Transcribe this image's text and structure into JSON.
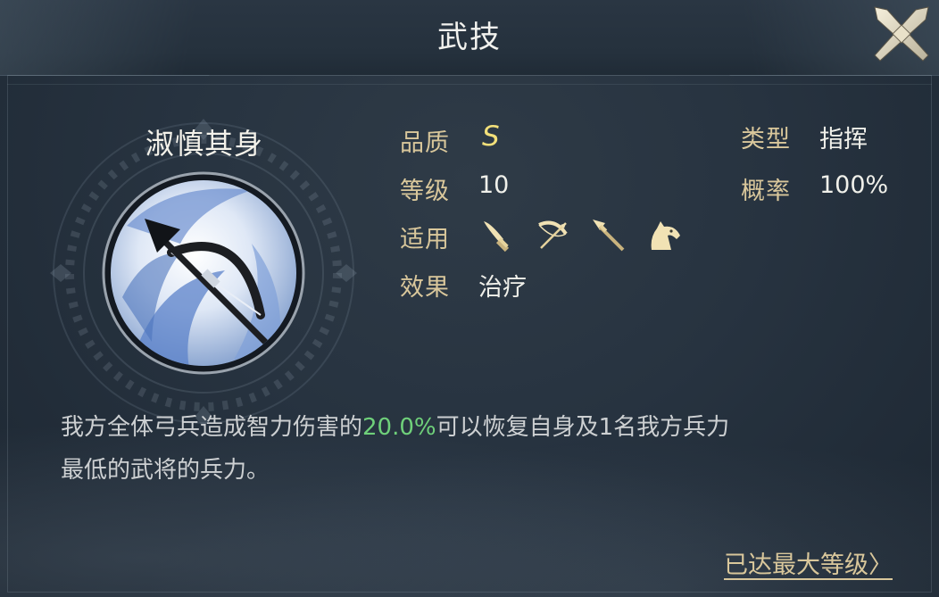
{
  "header": {
    "title": "武技"
  },
  "skill": {
    "name": "淑慎其身",
    "quality_label": "品质",
    "quality_value": "S",
    "level_label": "等级",
    "level_value": "10",
    "applicable_label": "适用",
    "applicable_icons": [
      "saber-icon",
      "bow-icon",
      "spear-icon",
      "horse-icon"
    ],
    "effect_label": "效果",
    "effect_value": "治疗",
    "type_label": "类型",
    "type_value": "指挥",
    "rate_label": "概率",
    "rate_value": "100%"
  },
  "description": {
    "part1": "我方全体弓兵造成智力伤害的",
    "highlight": "20.0%",
    "part2": "可以恢复自身及1名我方兵力",
    "line2": "最低的武将的兵力。"
  },
  "footer": {
    "max_level_link": "已达最大等级〉"
  },
  "colors": {
    "gold": "#d9c79b",
    "grade": "#f3e07a",
    "highlight_green": "#6fd07a",
    "background": "#273340"
  }
}
